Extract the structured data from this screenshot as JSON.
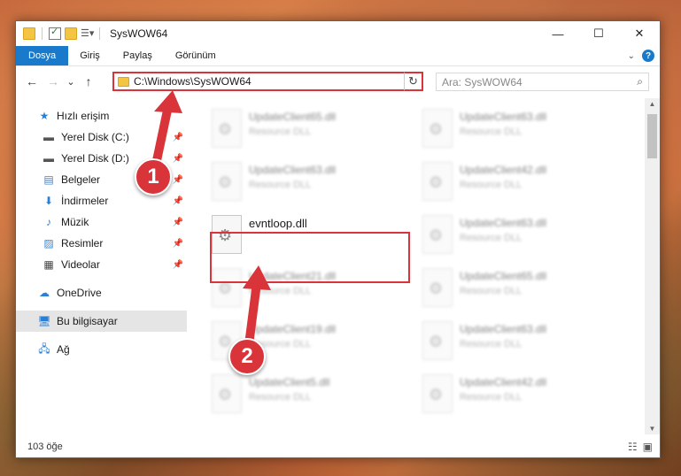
{
  "window": {
    "title": "SysWOW64",
    "controls": {
      "minimize": "—",
      "maximize": "☐",
      "close": "✕"
    }
  },
  "ribbon": {
    "tabs": [
      {
        "label": "Dosya",
        "active": true
      },
      {
        "label": "Giriş"
      },
      {
        "label": "Paylaş"
      },
      {
        "label": "Görünüm"
      }
    ],
    "expand_icon": "chevron-down-icon",
    "help_icon": "?"
  },
  "navbar": {
    "back": "←",
    "forward": "→",
    "recent": "⌄",
    "up": "↑",
    "address": "C:\\Windows\\SysWOW64",
    "refresh": "↻",
    "search_placeholder": "Ara: SysWOW64"
  },
  "sidebar": {
    "quick_access": "Hızlı erişim",
    "items": [
      {
        "label": "Yerel Disk (C:)",
        "icon": "drive-icon"
      },
      {
        "label": "Yerel Disk (D:)",
        "icon": "drive-icon"
      },
      {
        "label": "Belgeler",
        "icon": "documents-icon"
      },
      {
        "label": "İndirmeler",
        "icon": "downloads-icon"
      },
      {
        "label": "Müzik",
        "icon": "music-icon"
      },
      {
        "label": "Resimler",
        "icon": "pictures-icon"
      },
      {
        "label": "Videolar",
        "icon": "videos-icon"
      }
    ],
    "onedrive": "OneDrive",
    "this_pc": "Bu bilgisayar",
    "network": "Ağ"
  },
  "files": [
    {
      "name": "UpdateClient65.dll",
      "type": "Resource DLL",
      "blurred": true
    },
    {
      "name": "UpdateClient63.dll",
      "type": "Resource DLL",
      "blurred": true
    },
    {
      "name": "UpdateClient63.dll",
      "type": "Resource DLL",
      "blurred": true
    },
    {
      "name": "UpdateClient42.dll",
      "type": "Resource DLL",
      "blurred": true
    },
    {
      "name": "evntloop.dll",
      "type": "",
      "blurred": false,
      "highlighted": true
    },
    {
      "name": "UpdateClient63.dll",
      "type": "Resource DLL",
      "blurred": true
    },
    {
      "name": "UpdateClient21.dll",
      "type": "Resource DLL",
      "blurred": true
    },
    {
      "name": "UpdateClient65.dll",
      "type": "Resource DLL",
      "blurred": true
    },
    {
      "name": "UpdateClient19.dll",
      "type": "Resource DLL",
      "blurred": true
    },
    {
      "name": "UpdateClient63.dll",
      "type": "Resource DLL",
      "blurred": true
    },
    {
      "name": "UpdateClient5.dll",
      "type": "Resource DLL",
      "blurred": true
    },
    {
      "name": "UpdateClient42.dll",
      "type": "Resource DLL",
      "blurred": true
    }
  ],
  "status": {
    "item_count": "103 öğe"
  },
  "annotations": {
    "step1": "1",
    "step2": "2",
    "color": "#d9343a"
  }
}
